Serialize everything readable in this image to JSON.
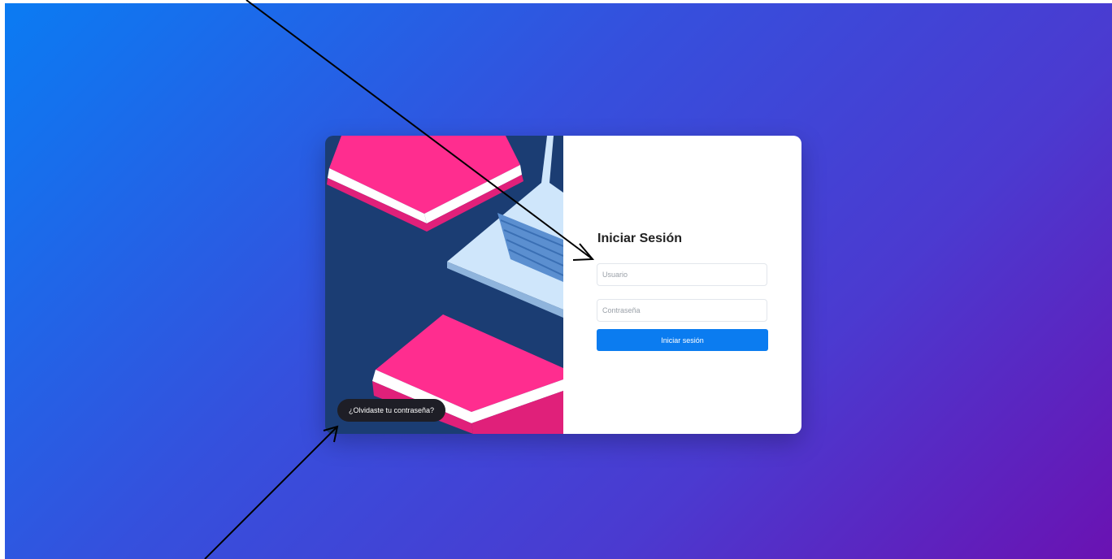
{
  "login": {
    "title": "Iniciar Sesión",
    "username_placeholder": "Usuario",
    "password_placeholder": "Contraseña",
    "submit_label": "Iniciar sesión",
    "forgot_password": "¿Olvidaste tu contraseña?"
  },
  "colors": {
    "background_start": "#0a7cf3",
    "background_end": "#6a12b2",
    "illustration_bg": "#1b3d73",
    "book": "#ff2d8f",
    "button": "#0b7cf0",
    "forgot_pill": "#1e1e26"
  },
  "icons": {
    "illustration": "books-and-laptop",
    "annotations": "arrow"
  }
}
